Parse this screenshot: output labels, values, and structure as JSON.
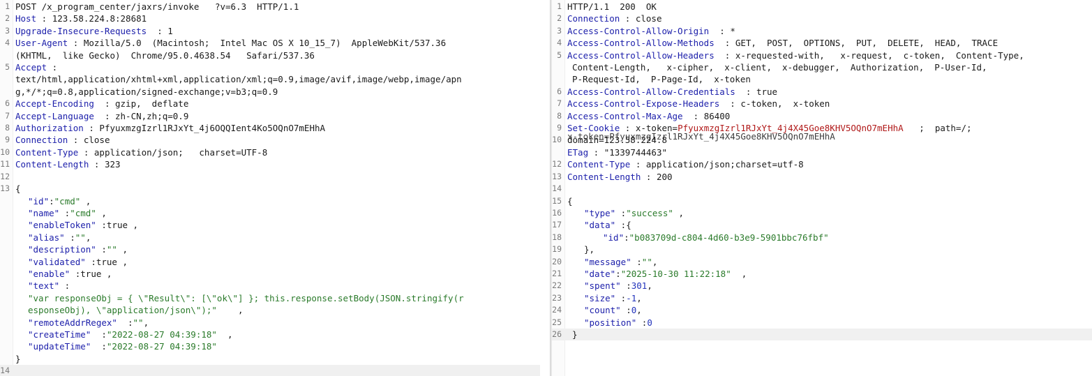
{
  "request": {
    "request_line": "POST /x_program_center/jaxrs/invoke   ?v=6.3  HTTP/1.1",
    "headers": [
      {
        "key": "Host",
        "sep": " : ",
        "value": "123.58.224.8:28681"
      },
      {
        "key": "Upgrade-Insecure-Requests",
        "sep": "  : ",
        "value": "1"
      },
      {
        "key": "User-Agent",
        "sep": " : ",
        "value": "Mozilla/5.0  (Macintosh;  Intel Mac OS X 10_15_7)  AppleWebKit/537.36",
        "cont": [
          "(KHTML,  like Gecko)  Chrome/95.0.4638.54   Safari/537.36"
        ]
      },
      {
        "key": "Accept",
        "sep": " :",
        "value": "",
        "cont": [
          "text/html,application/xhtml+xml,application/xml;q=0.9,image/avif,image/webp,image/apn",
          "g,*/*;q=0.8,application/signed-exchange;v=b3;q=0.9"
        ]
      },
      {
        "key": "Accept-Encoding",
        "sep": "  : ",
        "value": "gzip,  deflate"
      },
      {
        "key": "Accept-Language",
        "sep": "  : ",
        "value": "zh-CN,zh;q=0.9"
      },
      {
        "key": "Authorization",
        "sep": " : ",
        "value": "PfyuxmzgIzrl1RJxYt_4j6OQQIent4Ko5OQnO7mEHhA"
      },
      {
        "key": "Connection",
        "sep": " : ",
        "value": "close"
      },
      {
        "key": "Content-Type",
        "sep": " : ",
        "value": "application/json;   charset=UTF-8"
      },
      {
        "key": "Content-Length",
        "sep": " : ",
        "value": "323"
      }
    ],
    "body": {
      "open": "{",
      "id": {
        "key": "\"id\"",
        "val": "\"cmd\""
      },
      "name": {
        "key": "\"name\"",
        "val": "\"cmd\""
      },
      "enableToken": {
        "key": "\"enableToken\"",
        "val": "true"
      },
      "alias": {
        "key": "\"alias\"",
        "val": "\"\""
      },
      "description": {
        "key": "\"description\"",
        "val": "\"\""
      },
      "validated": {
        "key": "\"validated\"",
        "val": "true"
      },
      "enable": {
        "key": "\"enable\"",
        "val": "true"
      },
      "text": {
        "key": "\"text\"",
        "val_line1": "\"var responseObj = { \\\"Result\\\": [\\\"ok\\\"] }; this.response.setBody(JSON.stringify(r",
        "val_line2": "esponseObj), \\\"application/json\\\");\""
      },
      "remoteAddrRegex": {
        "key": "\"remoteAddrRegex\"",
        "val": "\"\""
      },
      "createTime": {
        "key": "\"createTime\"",
        "val": "\"2022-08-27 04:39:18\""
      },
      "updateTime": {
        "key": "\"updateTime\"",
        "val": "\"2022-08-27 04:39:18\""
      },
      "close": "}"
    },
    "line_numbers": [
      "1",
      "2",
      "3",
      "4",
      "5",
      "6",
      "7",
      "8",
      "9",
      "10",
      "11",
      "12",
      "13",
      "14"
    ]
  },
  "response": {
    "status_line": "HTTP/1.1  200  OK",
    "headers": [
      {
        "key": "Connection",
        "sep": " : ",
        "value": "close"
      },
      {
        "key": "Access-Control-Allow-Origin",
        "sep": "  : ",
        "value": "*"
      },
      {
        "key": "Access-Control-Allow-Methods",
        "sep": "  : ",
        "value": "GET,  POST,  OPTIONS,  PUT,  DELETE,  HEAD,  TRACE"
      },
      {
        "key": "Access-Control-Allow-Headers",
        "sep": "  : ",
        "value": "x-requested-with,   x-request,  c-token,  Content-Type,",
        "cont": [
          "Content-Length,   x-cipher,  x-client,  x-debugger,  Authorization,  P-User-Id,",
          "P-Request-Id,  P-Page-Id,  x-token"
        ]
      },
      {
        "key": "Access-Control-Allow-Credentials",
        "sep": "  : ",
        "value": "true"
      },
      {
        "key": "Access-Control-Expose-Headers",
        "sep": "  : ",
        "value": "c-token,  x-token"
      },
      {
        "key": "Access-Control-Max-Age",
        "sep": "  : ",
        "value": "86400"
      }
    ],
    "set_cookie": {
      "key": "Set-Cookie",
      "sep": " : ",
      "name": "x-token",
      "eq": "=",
      "value": "PfyuxmzgIzrl1RJxYt_4j4X45Goe8KHV5OQnO7mEHhA",
      "rest": "   ;  path=/;",
      "cont_under": "domain=123.58.224.8",
      "cont_over": "x-token=PfyuxmzgIzrl1RJxYt_4j4X45Goe8KHV5OQnO7mEHhA"
    },
    "etag": {
      "key": "ETag",
      "sep": " : ",
      "value": "\"1339744463\""
    },
    "content_type": {
      "key": "Content-Type",
      "sep": " : ",
      "value": "application/json;charset=utf-8"
    },
    "content_length": {
      "key": "Content-Length",
      "sep": " : ",
      "value": "200"
    },
    "body": {
      "open": "{",
      "type": {
        "key": "\"type\"",
        "val": "\"success\""
      },
      "data_key": "\"data\"",
      "data_open": "{",
      "data_id": {
        "key": "\"id\"",
        "val": "\"b083709d-c804-4d60-b3e9-5901bbc76fbf\""
      },
      "data_close": "},",
      "message": {
        "key": "\"message\"",
        "val": "\"\""
      },
      "date": {
        "key": "\"date\"",
        "val": "\"2025-10-30 11:22:18\""
      },
      "spent": {
        "key": "\"spent\"",
        "val": "301"
      },
      "size": {
        "key": "\"size\"",
        "val": "-1"
      },
      "count": {
        "key": "\"count\"",
        "val": "0"
      },
      "position": {
        "key": "\"position\"",
        "val": "0"
      },
      "close": "}"
    },
    "line_numbers": [
      "1",
      "2",
      "3",
      "4",
      "5",
      "6",
      "7",
      "8",
      "9",
      "10",
      "11",
      "12",
      "13",
      "14",
      "15",
      "16",
      "17",
      "18",
      "19",
      "20",
      "21",
      "22",
      "23",
      "24",
      "25",
      "26"
    ]
  }
}
